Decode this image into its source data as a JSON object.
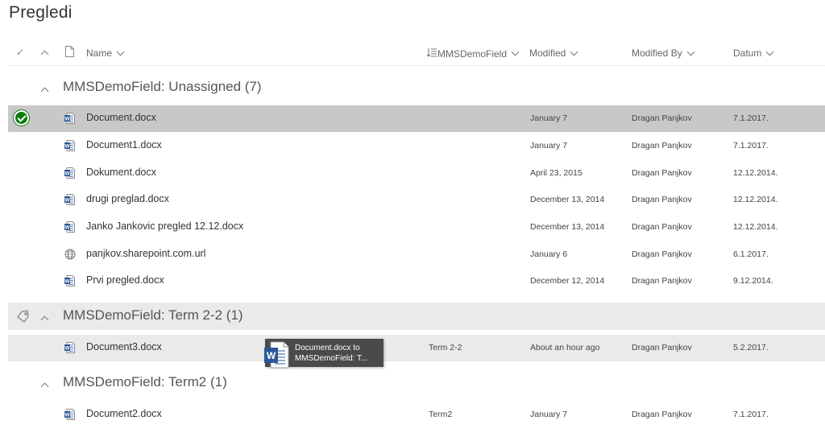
{
  "page": {
    "title": "Pregledi"
  },
  "columns": {
    "name": "Name",
    "mms": "MMSDemoField",
    "modified": "Modified",
    "modified_by": "Modified By",
    "datum": "Datum"
  },
  "groups": [
    {
      "label": "MMSDemoField: Unassigned (7)",
      "rows": [
        {
          "name": "Document.docx",
          "icon": "word-doc-icon",
          "mms": "",
          "modified": "January 7",
          "modified_by": "Dragan Panjkov",
          "datum": "7.1.2017.",
          "selected": true
        },
        {
          "name": "Document1.docx",
          "icon": "word-doc-icon",
          "mms": "",
          "modified": "January 7",
          "modified_by": "Dragan Panjkov",
          "datum": "7.1.2017."
        },
        {
          "name": "Dokument.docx",
          "icon": "word-doc-icon",
          "mms": "",
          "modified": "April 23, 2015",
          "modified_by": "Dragan Panjkov",
          "datum": "12.12.2014."
        },
        {
          "name": "drugi preglad.docx",
          "icon": "word-doc-icon",
          "mms": "",
          "modified": "December 13, 2014",
          "modified_by": "Dragan Panjkov",
          "datum": "12.12.2014."
        },
        {
          "name": "Janko Jankovic pregled 12.12.docx",
          "icon": "word-doc-icon",
          "mms": "",
          "modified": "December 13, 2014",
          "modified_by": "Dragan Panjkov",
          "datum": "12.12.2014."
        },
        {
          "name": "panjkov.sharepoint.com.url",
          "icon": "globe-icon",
          "mms": "",
          "modified": "January 6",
          "modified_by": "Dragan Panjkov",
          "datum": "6.1.2017."
        },
        {
          "name": "Prvi pregled.docx",
          "icon": "word-doc-icon",
          "mms": "",
          "modified": "December 12, 2014",
          "modified_by": "Dragan Panjkov",
          "datum": "9.12.2014."
        }
      ]
    },
    {
      "label": "MMSDemoField: Term 2-2 (1)",
      "rows": [
        {
          "name": "Document3.docx",
          "icon": "word-doc-icon",
          "mms": "Term 2-2",
          "modified": "About an hour ago",
          "modified_by": "Dragan Panjkov",
          "datum": "5.2.2017."
        }
      ]
    },
    {
      "label": "MMSDemoField: Term2 (1)",
      "rows": [
        {
          "name": "Document2.docx",
          "icon": "word-doc-icon",
          "mms": "Term2",
          "modified": "January 7",
          "modified_by": "Dragan Panjkov",
          "datum": "7.1.2017."
        }
      ]
    }
  ],
  "drag_tooltip": {
    "line1": "Document.docx to",
    "line2": "MMSDemoField: T..."
  },
  "colors": {
    "selected_row": "#c8c8c8",
    "shaded": "#eaeaea",
    "check": "#107c10",
    "word_blue": "#2b579a"
  }
}
